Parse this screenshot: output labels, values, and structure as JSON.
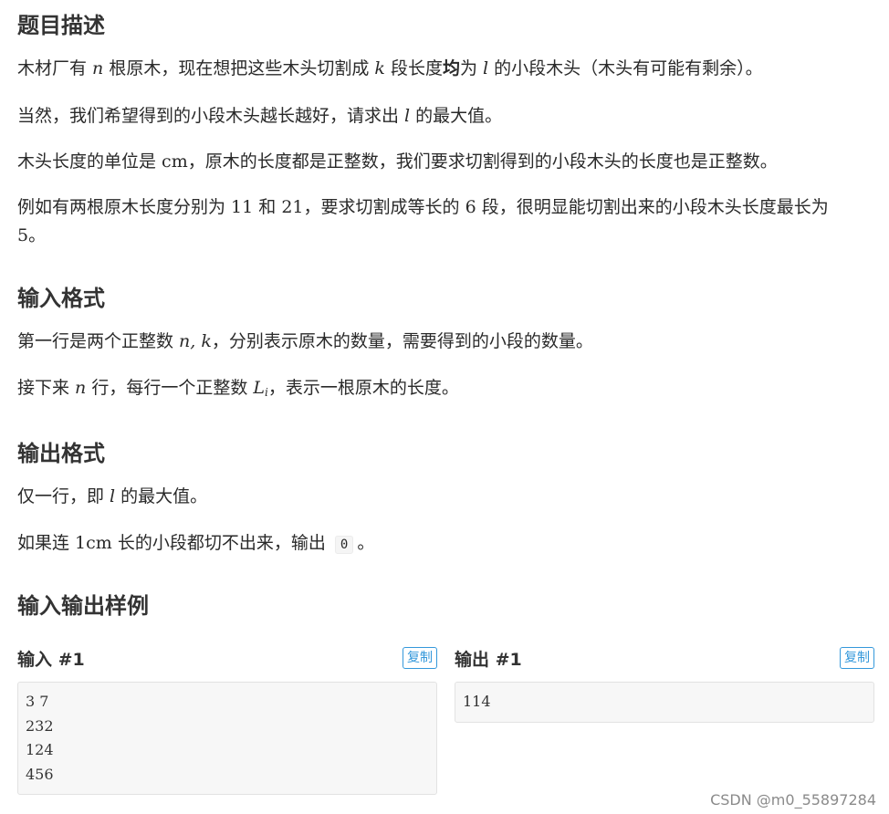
{
  "sections": {
    "description": {
      "title": "题目描述",
      "p1": {
        "a": "木材厂有 ",
        "n": "n",
        "b": " 根原木，现在想把这些木头切割成 ",
        "k": "k",
        "c": " 段长度",
        "bold": "均",
        "d": "为 ",
        "l": "l",
        "e": " 的小段木头（木头有可能有剩余）。"
      },
      "p2": {
        "a": "当然，我们希望得到的小段木头越长越好，请求出 ",
        "l": "l",
        "b": " 的最大值。"
      },
      "p3": {
        "a": "木头长度的单位是 ",
        "unit": "cm",
        "b": "，原木的长度都是正整数，我们要求切割得到的小段木头的长度也是正整数。"
      },
      "p4": {
        "a": "例如有两根原木长度分别为 ",
        "n1": "11",
        "b": " 和 ",
        "n2": "21",
        "c": "，要求切割成等长的 ",
        "n3": "6",
        "d": " 段，很明显能切割出来的小段木头长度最长为",
        "n4": "5",
        "e": "。"
      }
    },
    "input_format": {
      "title": "输入格式",
      "p1": {
        "a": "第一行是两个正整数 ",
        "vars": "n, k",
        "b": "，分别表示原木的数量，需要得到的小段的数量。"
      },
      "p2": {
        "a": "接下来 ",
        "n": "n",
        "b": " 行，每行一个正整数 ",
        "L": "L",
        "sub": "i",
        "c": "，表示一根原木的长度。"
      }
    },
    "output_format": {
      "title": "输出格式",
      "p1": {
        "a": "仅一行，即 ",
        "l": "l",
        "b": " 的最大值。"
      },
      "p2": {
        "a": "如果连 ",
        "val": "1cm",
        "b": " 长的小段都切不出来，输出 ",
        "code": "0",
        "c": "。"
      }
    },
    "samples": {
      "title": "输入输出样例",
      "input": {
        "label": "输入 #1",
        "copy": "复制",
        "lines": [
          "3 7",
          "232",
          "124",
          "456"
        ]
      },
      "output": {
        "label": "输出 #1",
        "copy": "复制",
        "lines": [
          "114"
        ]
      }
    }
  },
  "watermark": "CSDN @m0_55897284"
}
